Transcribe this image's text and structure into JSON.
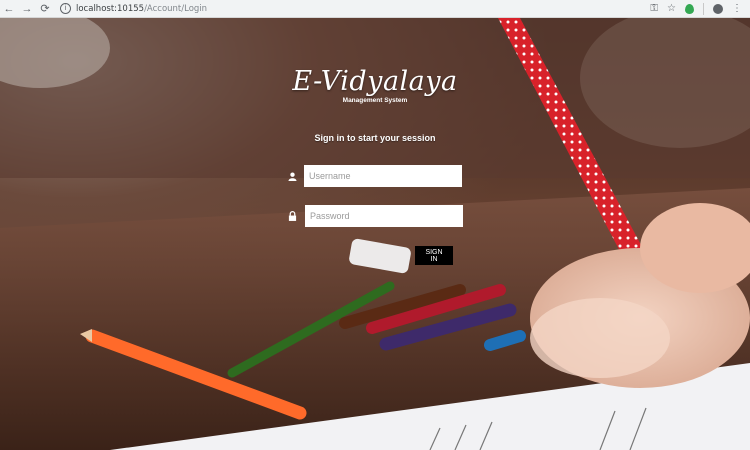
{
  "browser": {
    "url_host": "localhost:10155",
    "url_path": "/Account/Login",
    "icons": [
      "back-icon",
      "forward-icon",
      "reload-icon",
      "info-icon",
      "key-icon",
      "star-icon",
      "extension-icon",
      "profile-icon",
      "menu-icon"
    ]
  },
  "brand": {
    "title": "E-Vidyalaya",
    "subtitle": "Management System"
  },
  "form": {
    "heading": "Sign in to start your session",
    "username_placeholder": "Username",
    "password_placeholder": "Password",
    "submit_label": "SIGN IN"
  },
  "colors": {
    "button_bg": "#000000",
    "text": "#ffffff"
  }
}
